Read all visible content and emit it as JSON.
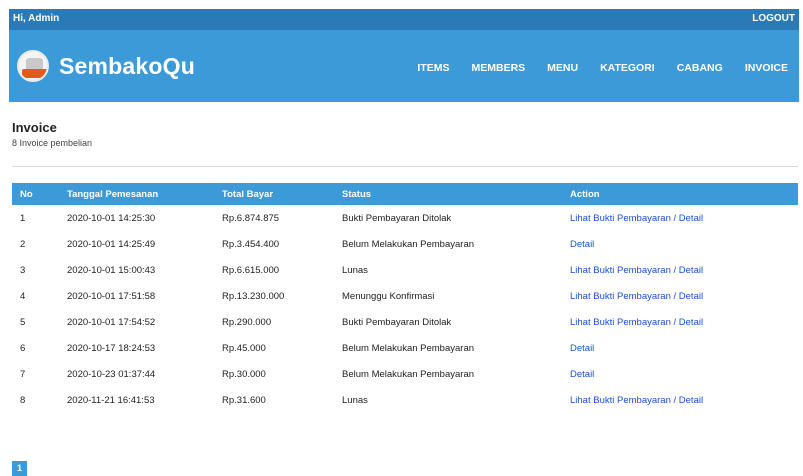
{
  "topbar": {
    "greeting": "Hi, Admin",
    "logout": "LOGOUT"
  },
  "navbar": {
    "brand": "SembakoQu",
    "items": [
      "ITEMS",
      "MEMBERS",
      "MENU",
      "KATEGORI",
      "CABANG",
      "INVOICE"
    ]
  },
  "page": {
    "title": "Invoice",
    "subtitle": "8 Invoice pembelian"
  },
  "table": {
    "headers": [
      "No",
      "Tanggal Pemesanan",
      "Total Bayar",
      "Status",
      "Action"
    ],
    "rows": [
      {
        "no": "1",
        "date": "2020-10-01 14:25:30",
        "total": "Rp.6.874.875",
        "status": "Bukti Pembayaran Ditolak",
        "action": "Lihat Bukti Pembayaran / Detail"
      },
      {
        "no": "2",
        "date": "2020-10-01 14:25:49",
        "total": "Rp.3.454.400",
        "status": "Belum Melakukan Pembayaran",
        "action": "Detail"
      },
      {
        "no": "3",
        "date": "2020-10-01 15:00:43",
        "total": "Rp.6.615.000",
        "status": "Lunas",
        "action": "Lihat Bukti Pembayaran / Detail"
      },
      {
        "no": "4",
        "date": "2020-10-01 17:51:58",
        "total": "Rp.13.230.000",
        "status": "Menunggu Konfirmasi",
        "action": "Lihat Bukti Pembayaran / Detail"
      },
      {
        "no": "5",
        "date": "2020-10-01 17:54:52",
        "total": "Rp.290.000",
        "status": "Bukti Pembayaran Ditolak",
        "action": "Lihat Bukti Pembayaran / Detail"
      },
      {
        "no": "6",
        "date": "2020-10-17 18:24:53",
        "total": "Rp.45.000",
        "status": "Belum Melakukan Pembayaran",
        "action": "Detail"
      },
      {
        "no": "7",
        "date": "2020-10-23 01:37:44",
        "total": "Rp.30.000",
        "status": "Belum Melakukan Pembayaran",
        "action": "Detail"
      },
      {
        "no": "8",
        "date": "2020-11-21 16:41:53",
        "total": "Rp.31.600",
        "status": "Lunas",
        "action": "Lihat Bukti Pembayaran / Detail"
      }
    ]
  },
  "pagination": {
    "current": "1"
  },
  "colors": {
    "topbar": "#2a7ab8",
    "navbar": "#3d9ad9",
    "link": "#1a4fd8"
  },
  "icons": {
    "logo": "shopping-bag-logo-icon"
  }
}
